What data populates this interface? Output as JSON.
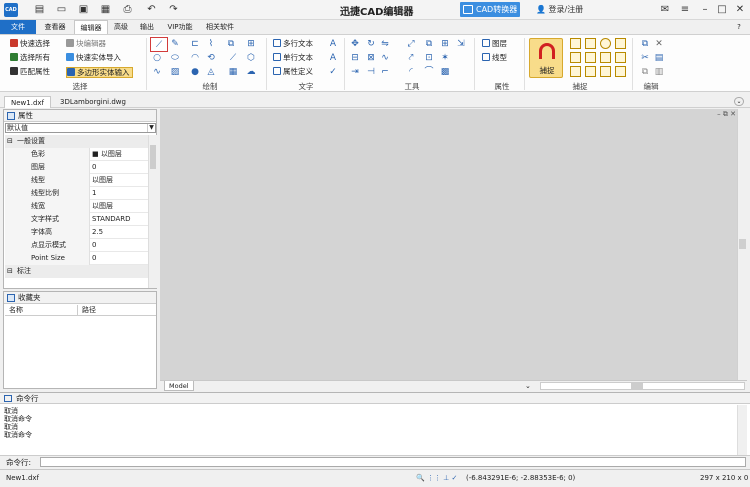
{
  "titlebar": {
    "logo": "CAD",
    "title": "迅捷CAD编辑器",
    "cad_convert": "CAD转换器",
    "login": "登录/注册"
  },
  "tabs": [
    "文件",
    "查看器",
    "编辑器",
    "高级",
    "输出",
    "VIP功能",
    "相关软件"
  ],
  "ribbon": {
    "select_group": {
      "items": [
        "快速选择",
        "选择所有",
        "匹配属性"
      ],
      "items2": [
        "块编辑器",
        "快速实体导入",
        "多边形实体输入"
      ],
      "label": "选择"
    },
    "draw_group_label": "绘制",
    "text_group": {
      "items": [
        "多行文本",
        "单行文本",
        "属性定义"
      ],
      "label": "文字"
    },
    "tools_group_label": "工具",
    "props_group": {
      "items": [
        "图层",
        "线型"
      ],
      "label": "属性"
    },
    "snap_group": {
      "button": "捕捉",
      "label": "捕捉"
    },
    "edit_group_label": "编辑"
  },
  "doc_tabs": [
    "New1.dxf",
    "3DLamborgini.dwg"
  ],
  "props_panel": {
    "title": "属性",
    "select_value": "默认值",
    "rows": [
      {
        "k": "一般设置",
        "v": "",
        "cat": true
      },
      {
        "k": "色彩",
        "v": "■ 以图层",
        "cat": false
      },
      {
        "k": "图层",
        "v": "0",
        "cat": false
      },
      {
        "k": "线型",
        "v": "以图层",
        "cat": false
      },
      {
        "k": "线型比例",
        "v": "1",
        "cat": false
      },
      {
        "k": "线宽",
        "v": "以图层",
        "cat": false
      },
      {
        "k": "文字样式",
        "v": "STANDARD",
        "cat": false
      },
      {
        "k": "字体高",
        "v": "2.5",
        "cat": false
      },
      {
        "k": "点显示模式",
        "v": "0",
        "cat": false
      },
      {
        "k": "Point Size",
        "v": "0",
        "cat": false
      },
      {
        "k": "标注",
        "v": "",
        "cat": true
      }
    ]
  },
  "fav_panel": {
    "title": "收藏夹",
    "col_name": "名称",
    "col_path": "路径"
  },
  "canvas": {
    "model_tab": "Model"
  },
  "command": {
    "title": "命令行",
    "lines": [
      "取消",
      "取消命令",
      "取消",
      "取消命令"
    ],
    "input_label": "命令行:"
  },
  "status": {
    "file": "New1.dxf",
    "coords": "(-6.843291E-6; -2.88353E-6; 0)",
    "size": "297 x 210 x 0"
  }
}
